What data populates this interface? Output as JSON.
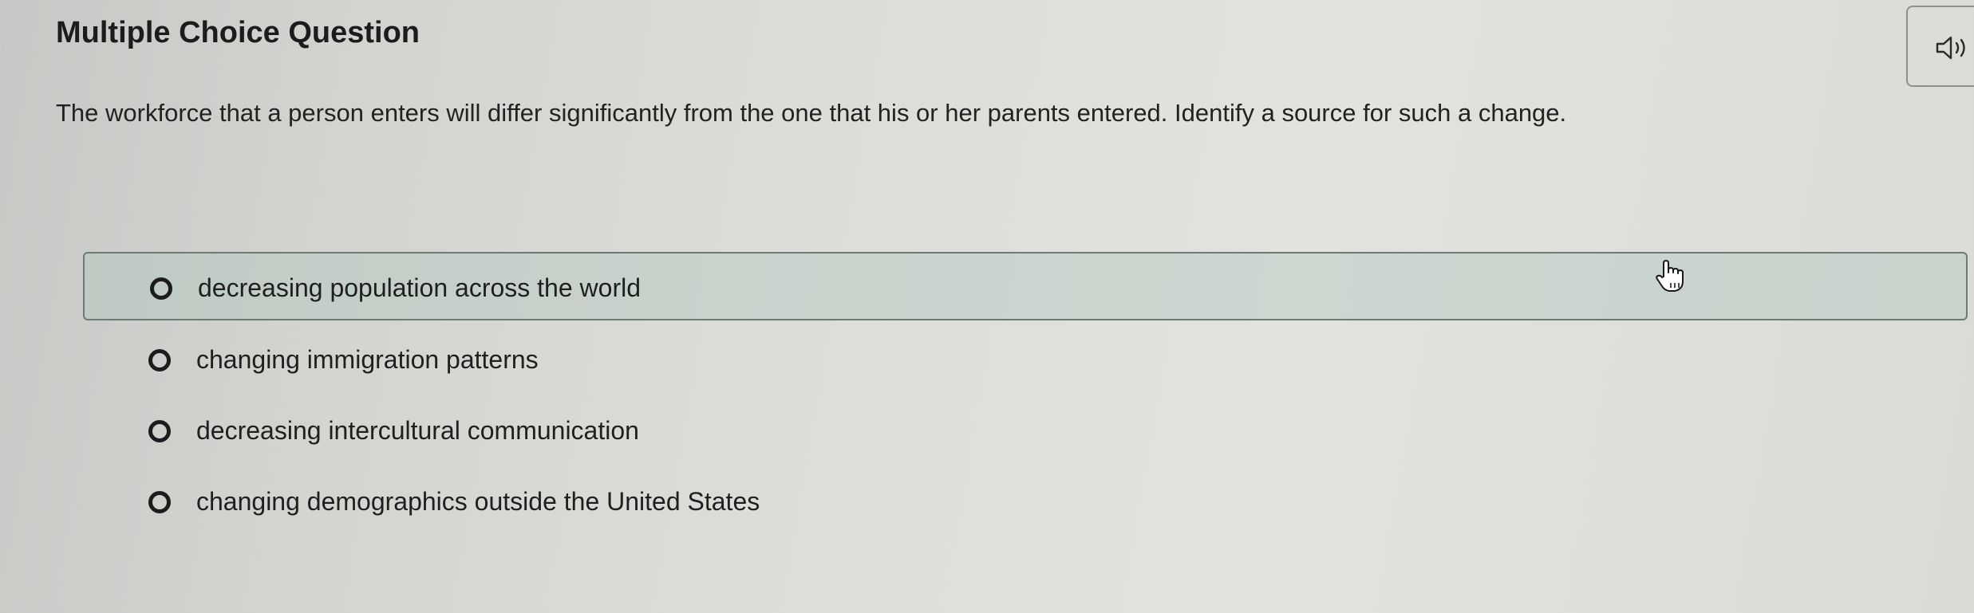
{
  "header": {
    "title": "Multiple Choice Question"
  },
  "audio": {
    "icon": "speaker-icon"
  },
  "question": {
    "text": "The workforce that a person enters will differ significantly from the one that his or her parents entered. Identify a source for such a change."
  },
  "options": [
    {
      "label": "decreasing population across the world",
      "selected": false,
      "hovered": true
    },
    {
      "label": "changing immigration patterns",
      "selected": false,
      "hovered": false
    },
    {
      "label": "decreasing intercultural communication",
      "selected": false,
      "hovered": false
    },
    {
      "label": "changing demographics outside the United States",
      "selected": false,
      "hovered": false
    }
  ],
  "colors": {
    "hover_background": "#b7c9c1",
    "hover_border": "#6f7a76",
    "text": "#1e1e1e"
  }
}
